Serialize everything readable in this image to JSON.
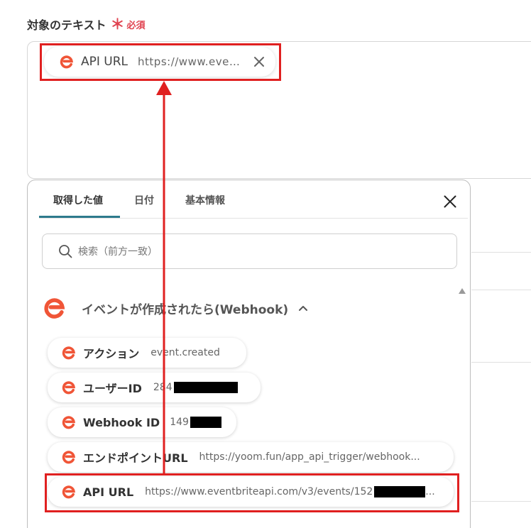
{
  "field": {
    "label": "対象のテキスト",
    "required_mark": "＊",
    "required_text": "必須"
  },
  "selected_tag": {
    "label": "API URL",
    "value": "https://www.even..."
  },
  "panel": {
    "tabs": [
      {
        "label": "取得した値",
        "active": true
      },
      {
        "label": "日付",
        "active": false
      },
      {
        "label": "基本情報",
        "active": false
      }
    ],
    "search": {
      "placeholder": "検索（前方一致）"
    },
    "section": {
      "title": "イベントが作成されたら(Webhook)",
      "expanded": true
    },
    "items": [
      {
        "label": "アクション",
        "value": "event.created"
      },
      {
        "label": "ユーザーID",
        "value": "284"
      },
      {
        "label": "Webhook ID",
        "value": "149"
      },
      {
        "label": "エンドポイントURL",
        "value": "https://yoom.fun/app_api_trigger/webhook..."
      },
      {
        "label": "API URL",
        "value": "https://www.eventbriteapi.com/v3/events/152",
        "value_suffix": "..."
      }
    ]
  },
  "icons": {
    "app_logo": "eventbrite-e-icon",
    "close": "close-icon",
    "search": "search-icon",
    "chevron": "chevron-up-icon"
  },
  "colors": {
    "brand": "#f05537",
    "required": "#e0424f",
    "tab_underline": "#2d7a8c",
    "annotation": "#e02020"
  }
}
